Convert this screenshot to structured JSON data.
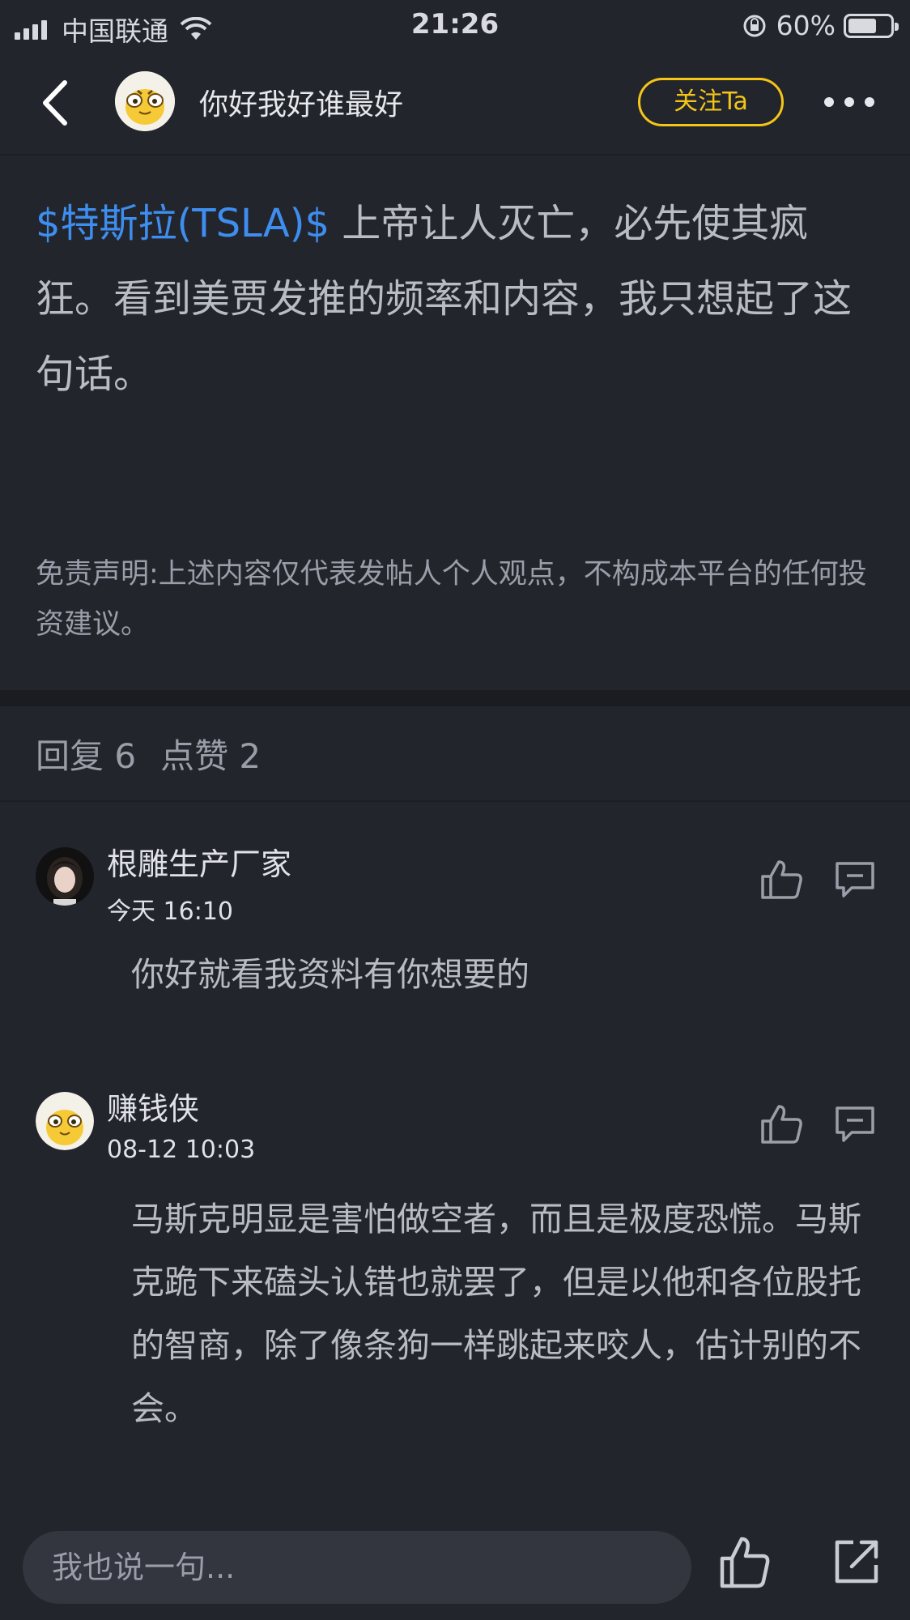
{
  "status_bar": {
    "carrier": "中国联通",
    "time": "21:26",
    "battery": "60%"
  },
  "header": {
    "username": "你好我好谁最好",
    "follow_label": "关注Ta"
  },
  "post": {
    "ticker": "$特斯拉(TSLA)$",
    "text": " 上帝让人灭亡，必先使其疯狂。看到美贾发推的频率和内容，我只想起了这句话。",
    "disclaimer": "免责声明:上述内容仅代表发帖人个人观点，不构成本平台的任何投资建议。"
  },
  "stats": {
    "replies": "回复 6",
    "likes": "点赞 2"
  },
  "comments": [
    {
      "name": "根雕生产厂家",
      "time": "今天 16:10",
      "text": "你好就看我资料有你想要的"
    },
    {
      "name": "赚钱侠",
      "time": "08-12 10:03",
      "text": "马斯克明显是害怕做空者，而且是极度恐慌。马斯克跪下来磕头认错也就罢了，但是以他和各位股托的智商，除了像条狗一样跳起来咬人，估计别的不会。"
    }
  ],
  "bottom_bar": {
    "input_placeholder": "我也说一句..."
  },
  "colors": {
    "background": "#23252d",
    "accent_blue": "#3e8ef0",
    "follow_yellow": "#f5c518"
  }
}
